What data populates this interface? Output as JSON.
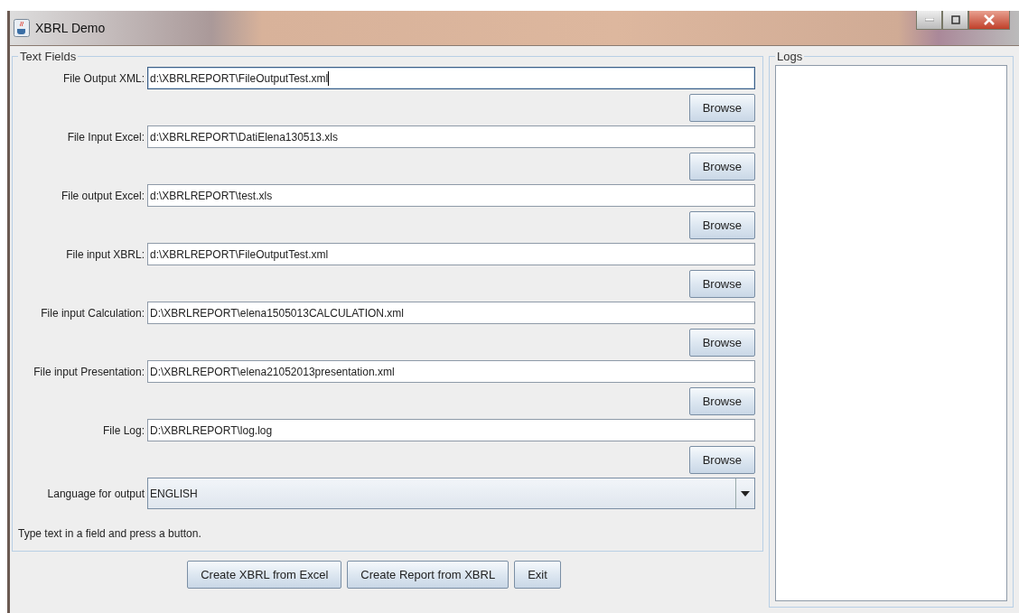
{
  "window": {
    "title": "XBRL Demo"
  },
  "text_fields": {
    "title": "Text Fields",
    "fields": [
      {
        "label": "File Output XML:",
        "value": "d:\\XBRLREPORT\\FileOutputTest.xml",
        "focused": true,
        "button": "Browse"
      },
      {
        "label": "File Input Excel:",
        "value": "d:\\XBRLREPORT\\DatiElena130513.xls",
        "focused": false,
        "button": "Browse"
      },
      {
        "label": "File output Excel:",
        "value": "d:\\XBRLREPORT\\test.xls",
        "focused": false,
        "button": "Browse"
      },
      {
        "label": "File input XBRL:",
        "value": "d:\\XBRLREPORT\\FileOutputTest.xml",
        "focused": false,
        "button": "Browse"
      },
      {
        "label": "File input Calculation:",
        "value": "D:\\XBRLREPORT\\elena1505013CALCULATION.xml",
        "focused": false,
        "button": "Browse"
      },
      {
        "label": "File input Presentation:",
        "value": "D:\\XBRLREPORT\\elena21052013presentation.xml",
        "focused": false,
        "button": "Browse"
      },
      {
        "label": "File Log:",
        "value": "D:\\XBRLREPORT\\log.log",
        "focused": false,
        "button": "Browse"
      }
    ],
    "language": {
      "label": "Language for output",
      "value": "ENGLISH"
    },
    "hint": "Type text in a field and press a button."
  },
  "buttons": [
    "Create XBRL from Excel",
    "Create Report from XBRL",
    "Exit"
  ],
  "logs": {
    "title": "Logs"
  }
}
